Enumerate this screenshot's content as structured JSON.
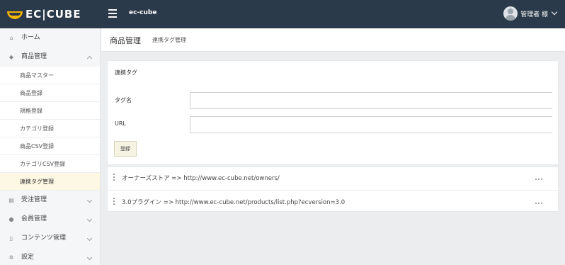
{
  "header": {
    "logo_text": "EC|CUBE",
    "shop_name": "ec-cube",
    "user_name": "管理者 様"
  },
  "sidebar": {
    "items": [
      {
        "label": "ホーム",
        "icon": "home-icon"
      },
      {
        "label": "商品管理",
        "icon": "tag-icon"
      },
      {
        "label": "受注管理",
        "icon": "cart-icon"
      },
      {
        "label": "会員管理",
        "icon": "users-icon"
      },
      {
        "label": "コンテンツ管理",
        "icon": "file-icon"
      },
      {
        "label": "設定",
        "icon": "gear-icon"
      }
    ],
    "sub_items": [
      {
        "label": "商品マスター"
      },
      {
        "label": "商品登録"
      },
      {
        "label": "規格登録"
      },
      {
        "label": "カテゴリ登録"
      },
      {
        "label": "商品CSV登録"
      },
      {
        "label": "カテゴリCSV登録"
      },
      {
        "label": "連携タグ管理"
      }
    ]
  },
  "page": {
    "title": "商品管理",
    "subtitle": "連携タグ管理"
  },
  "form": {
    "card_title": "連携タグ",
    "tag_name_label": "タグ名",
    "tag_name_value": "",
    "url_label": "URL",
    "url_value": "",
    "register_button": "登録"
  },
  "tag_list": [
    {
      "text": "オーナーズストア => http://www.ec-cube.net/owners/"
    },
    {
      "text": "3.0プラグイン => http://www.ec-cube.net/products/list.php?ecversion=3.0"
    }
  ],
  "colors": {
    "header_bg": "#2b3a4a",
    "logo_accent": "#f5b400",
    "active_sub_bg": "#fdf8e4"
  }
}
